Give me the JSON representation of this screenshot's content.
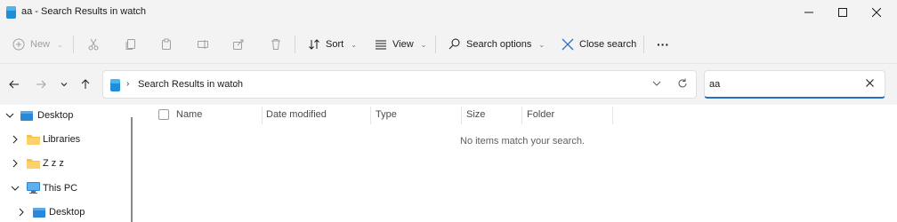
{
  "window": {
    "title": "aa - Search Results in watch",
    "icons": {
      "app": "search-folder-icon",
      "minimize": "minimize-icon",
      "maximize": "maximize-icon",
      "close": "close-icon"
    }
  },
  "commandbar": {
    "new_label": "New",
    "sort_label": "Sort",
    "view_label": "View",
    "search_options_label": "Search options",
    "close_search_label": "Close search",
    "more_label": "···",
    "icons": [
      "new-icon",
      "cut-icon",
      "copy-icon",
      "paste-icon",
      "rename-icon",
      "share-icon",
      "delete-icon",
      "sort-icon",
      "view-icon",
      "search-options-icon",
      "close-search-icon",
      "more-icon"
    ]
  },
  "navbar": {
    "breadcrumb_separator": "›",
    "location_label": "Search Results in watch",
    "search_value": "aa",
    "icons": [
      "back-icon",
      "forward-icon",
      "recent-locations-icon",
      "up-icon",
      "address-dropdown-icon",
      "refresh-icon",
      "clear-search-icon"
    ]
  },
  "sidebar": {
    "items": [
      {
        "label": "Desktop",
        "icon": "desktop-icon",
        "expanded": true
      },
      {
        "label": "Libraries",
        "icon": "folder-icon",
        "expanded": false
      },
      {
        "label": "Z z z",
        "icon": "folder-icon",
        "expanded": false
      },
      {
        "label": "This PC",
        "icon": "pc-icon",
        "expanded": true
      },
      {
        "label": "Desktop",
        "icon": "desktop-icon",
        "expanded": false
      }
    ]
  },
  "content": {
    "columns": [
      "Name",
      "Date modified",
      "Type",
      "Size",
      "Folder"
    ],
    "empty_message": "No items match your search."
  },
  "colors": {
    "accent": "#2b6cc4",
    "chrome": "#f3f3f3",
    "folder": "#f8c24a",
    "desktop": "#2b88d8"
  }
}
